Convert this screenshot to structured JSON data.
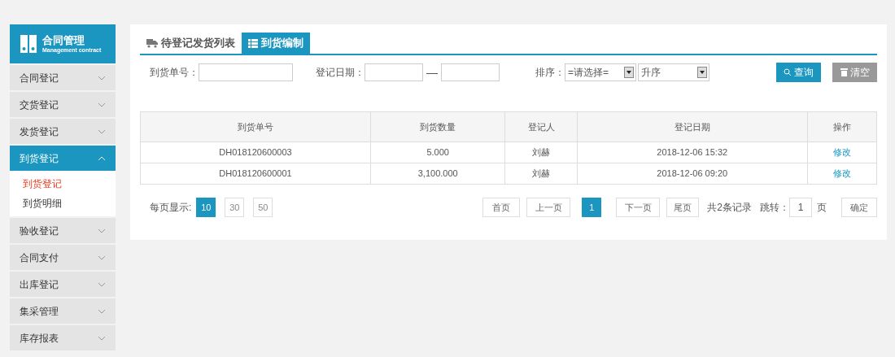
{
  "sidebar": {
    "title": "合同管理",
    "subtitle": "Management contract",
    "items": [
      {
        "label": "合同登记",
        "expanded": false
      },
      {
        "label": "交货登记",
        "expanded": false
      },
      {
        "label": "发货登记",
        "expanded": false
      },
      {
        "label": "到货登记",
        "expanded": true,
        "children": [
          {
            "label": "到货登记",
            "selected": true
          },
          {
            "label": "到货明细",
            "selected": false
          }
        ]
      },
      {
        "label": "验收登记",
        "expanded": false
      },
      {
        "label": "合同支付",
        "expanded": false
      },
      {
        "label": "出库登记",
        "expanded": false
      },
      {
        "label": "集采管理",
        "expanded": false
      },
      {
        "label": "库存报表",
        "expanded": false
      }
    ]
  },
  "tabs": [
    {
      "label": "待登记发货列表",
      "selected": false,
      "kind": "truck"
    },
    {
      "label": "到货编制",
      "selected": true,
      "kind": "list"
    }
  ],
  "filters": {
    "number_label": "到货单号：",
    "date_label": "登记日期：",
    "date_separator": "—",
    "sort_label": "排序：",
    "sort_value": "=请选择=",
    "order_value": "升序",
    "search_button": "查询",
    "clear_button": "清空"
  },
  "table": {
    "columns": [
      "到货单号",
      "到货数量",
      "登记人",
      "登记日期",
      "操作"
    ],
    "rows": [
      [
        "DH018120600003",
        "5.000",
        "刘赫",
        "2018-12-06 15:32",
        "修改"
      ],
      [
        "DH018120600001",
        "3,100.000",
        "刘赫",
        "2018-12-06 09:20",
        "修改"
      ]
    ]
  },
  "pagination": {
    "page_size_label": "每页显示:",
    "page_sizes": [
      {
        "label": "10",
        "selected": true
      },
      {
        "label": "30",
        "selected": false
      },
      {
        "label": "50",
        "selected": false
      }
    ],
    "first": "首页",
    "prev": "上一页",
    "pages": [
      {
        "label": "1",
        "selected": true
      }
    ],
    "next": "下一页",
    "last": "尾页",
    "total": "共2条记录",
    "jump_label": "跳转：",
    "jump_value": "1",
    "page_unit": "页",
    "confirm": "确定"
  }
}
